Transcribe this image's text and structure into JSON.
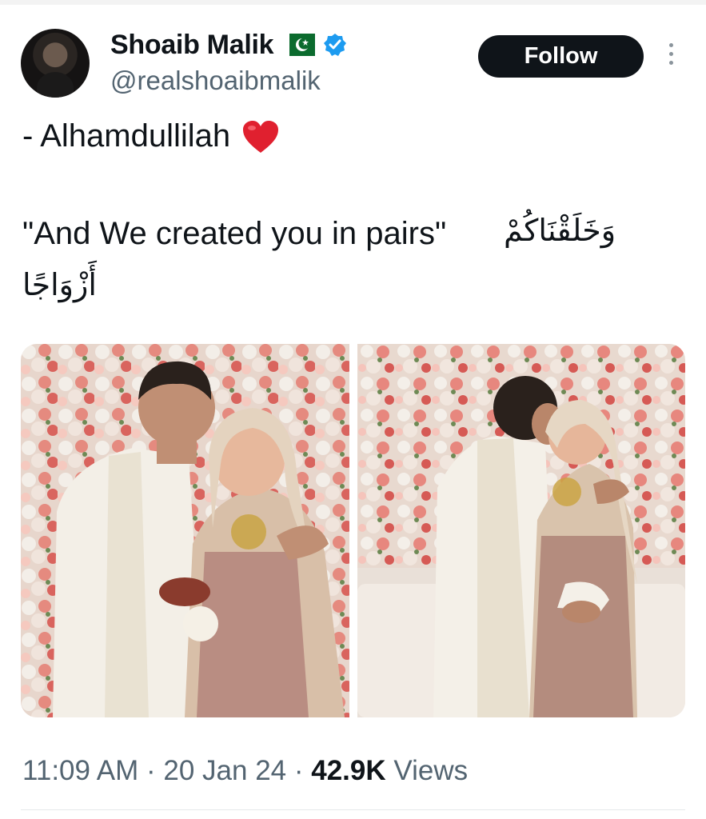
{
  "author": {
    "name": "Shoaib Malik",
    "handle": "@realshoaibmalik",
    "flag_icon": "pakistan-flag",
    "verified_icon": "verified-badge",
    "verified_color": "#1d9bf0"
  },
  "actions": {
    "follow_label": "Follow",
    "more_icon": "more-vertical-icon"
  },
  "tweet": {
    "line1": "- Alhamdullilah",
    "line1_emoji": "red-heart",
    "line2": "\"And We created you in pairs\"",
    "arabic_part1": "وَخَلَقْنَاكُمْ",
    "arabic_part2": "أَزْوَاجًا"
  },
  "media": [
    {
      "alt": "photo-1",
      "label": ""
    },
    {
      "alt": "photo-2",
      "label": ""
    }
  ],
  "meta": {
    "time": "11:09 AM",
    "separator": " · ",
    "date": "20 Jan 24",
    "views_count": "42.9K",
    "views_label": "Views"
  },
  "colors": {
    "text": "#0f1419",
    "secondary": "#536471",
    "button_bg": "#0f1419",
    "heart": "#e0202f"
  }
}
